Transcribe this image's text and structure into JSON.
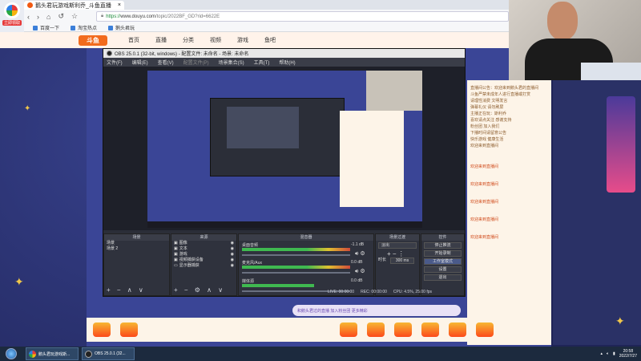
{
  "browser": {
    "tab_title": "鹅头君玩游戏斯利乔_斗鱼直播",
    "logo_badge": "立即领取",
    "url_scheme": "https://",
    "url_host": "www.douyu.com",
    "url_path": "/topic/2022BF_GD?rid=6622E",
    "bookmarks": [
      "百度",
      "百度一下",
      "淘宝热点",
      "鹅头君玩"
    ]
  },
  "douyu": {
    "logo": "斗鱼",
    "nav": [
      "首页",
      "直播",
      "分类",
      "视频",
      "游戏",
      "鱼吧"
    ],
    "chat_lines": [
      "直播间公告：欢迎来到鹅头君的直播间",
      "斗鱼严禁未成年人进行直播或打赏",
      "请理性消费 文明发言",
      "弹幕礼仪 请勿刷屏",
      "主播正在玩：斯利乔",
      "喜欢请点关注 感谢支持",
      "粉丝团 加入我们",
      "下播时间请留意公告",
      "快乐游戏 健康生活",
      "欢迎来到直播间"
    ],
    "chat_highlights": [
      "欢迎来到直播间",
      "欢迎来到直播间",
      "欢迎来到直播间",
      "欢迎来到直播间",
      "欢迎来到直播间"
    ],
    "danmu_placeholder": "和鹅头君过的直播 加入粉丝团 更多精彩"
  },
  "obs": {
    "title": "OBS 25.0.1 (32-bit, windows) - 配置文件: 未命名 - 场景: 未命名",
    "menu": [
      "文件(F)",
      "编辑(E)",
      "查看(V)",
      "配置文件(P)",
      "场景集合(S)",
      "工具(T)",
      "帮助(H)"
    ],
    "docks": {
      "scenes": "场景",
      "sources": "来源",
      "mixer": "混音器",
      "transitions": "场景过渡",
      "controls": "控件"
    },
    "scenes": [
      "场景",
      "场景 2"
    ],
    "sources": [
      "图像",
      "文本",
      "游戏",
      "视频捕获设备",
      "显示器捕获"
    ],
    "mixer": [
      {
        "label": "桌面音频",
        "db": "-1.1 dB"
      },
      {
        "label": "麦克风/Aux",
        "db": "0.0 dB"
      },
      {
        "label": "媒体源",
        "db": "0.0 dB"
      }
    ],
    "transition_mode": "淡出",
    "duration_label": "时长",
    "duration_value": "300 ms",
    "controls": [
      "停止推流",
      "开始录制",
      "工作室模式",
      "设置",
      "退出"
    ],
    "status": {
      "live": "LIVE: 00:00:00",
      "rec": "REC: 00:00:00",
      "cpu": "CPU: 4.5%, 25.00 fps"
    }
  },
  "taskbar": {
    "tasks": [
      "鹅头君玩游戏斯...",
      "OBS 25.0.1 (32..."
    ],
    "time": "20:58",
    "date": "2022/7/27"
  }
}
